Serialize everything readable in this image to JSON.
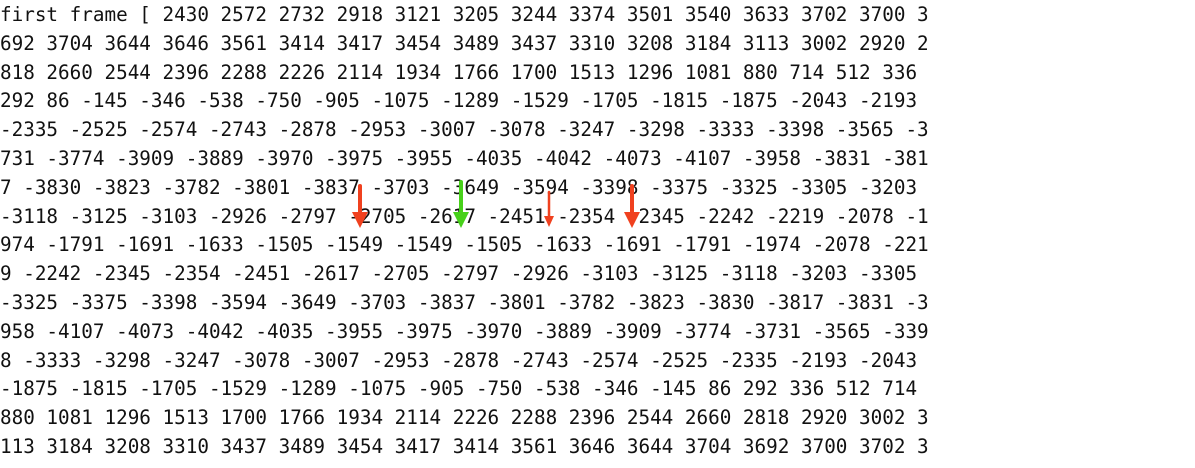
{
  "text_lines": [
    "first frame [ 2430 2572 2732 2918 3121 3205 3244 3374 3501 3540 3633 3702 3700 3",
    "692 3704 3644 3646 3561 3414 3417 3454 3489 3437 3310 3208 3184 3113 3002 2920 2",
    "818 2660 2544 2396 2288 2226 2114 1934 1766 1700 1513 1296 1081 880 714 512 336",
    "292 86 -145 -346 -538 -750 -905 -1075 -1289 -1529 -1705 -1815 -1875 -2043 -2193",
    "-2335 -2525 -2574 -2743 -2878 -2953 -3007 -3078 -3247 -3298 -3333 -3398 -3565 -3",
    "731 -3774 -3909 -3889 -3970 -3975 -3955 -4035 -4042 -4073 -4107 -3958 -3831 -381",
    "7 -3830 -3823 -3782 -3801 -3837 -3703 -3649 -3594 -3398 -3375 -3325 -3305 -3203",
    "-3118 -3125 -3103 -2926 -2797 -2705 -2617 -2451 -2354 -2345 -2242 -2219 -2078 -1",
    "974 -1791 -1691 -1633 -1505 -1549 -1549 -1505 -1633 -1691 -1791 -1974 -2078 -221",
    "9 -2242 -2345 -2354 -2451 -2617 -2705 -2797 -2926 -3103 -3125 -3118 -3203 -3305",
    "-3325 -3375 -3398 -3594 -3649 -3703 -3837 -3801 -3782 -3823 -3830 -3817 -3831 -3",
    "958 -4107 -4073 -4042 -4035 -3955 -3975 -3970 -3889 -3909 -3774 -3731 -3565 -339",
    "8 -3333 -3298 -3247 -3078 -3007 -2953 -2878 -2743 -2574 -2525 -2335 -2193 -2043",
    "-1875 -1815 -1705 -1529 -1289 -1075 -905 -750 -538 -346 -145 86 292 336 512 714",
    "880 1081 1296 1513 1700 1766 1934 2114 2226 2288 2396 2544 2660 2818 2920 3002 3",
    "113 3184 3208 3310 3437 3489 3454 3417 3414 3561 3646 3644 3704 3692 3700 3702 3"
  ],
  "annotations": [
    {
      "icon": "down-arrow-icon",
      "color": "#f0411f"
    },
    {
      "icon": "down-arrow-icon",
      "color": "#47d11a"
    },
    {
      "icon": "down-arrow-icon",
      "color": "#f0411f"
    },
    {
      "icon": "down-arrow-icon",
      "color": "#f0411f"
    }
  ]
}
